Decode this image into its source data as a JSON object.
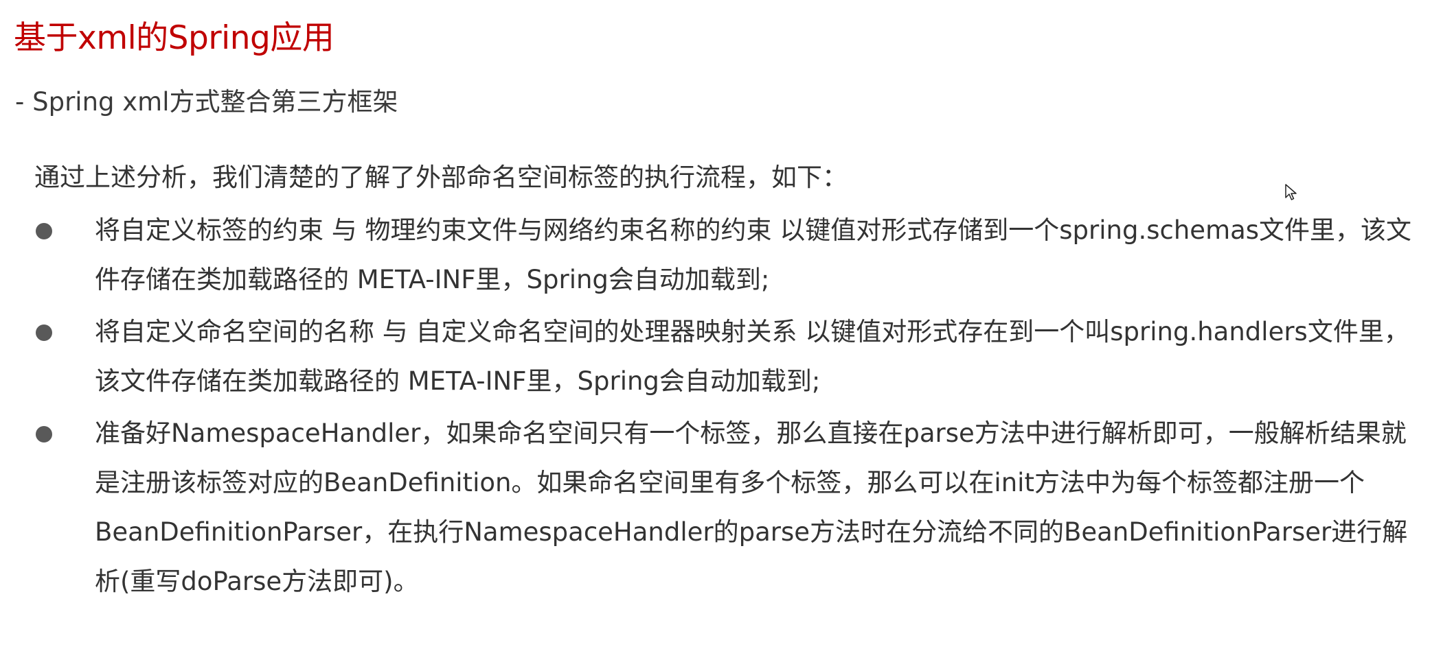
{
  "title": "基于xml的Spring应用",
  "subtitle": "- Spring xml方式整合第三方框架",
  "intro": "通过上述分析，我们清楚的了解了外部命名空间标签的执行流程，如下：",
  "bullets": [
    {
      "text": "将自定义标签的约束 与 物理约束文件与网络约束名称的约束 以键值对形式存储到一个spring.schemas文件里，该文件存储在类加载路径的 META-INF里，Spring会自动加载到;"
    },
    {
      "text": "将自定义命名空间的名称 与 自定义命名空间的处理器映射关系 以键值对形式存在到一个叫spring.handlers文件里，该文件存储在类加载路径的 META-INF里，Spring会自动加载到;"
    },
    {
      "text": "准备好NamespaceHandler，如果命名空间只有一个标签，那么直接在parse方法中进行解析即可，一般解析结果就是注册该标签对应的BeanDefinition。如果命名空间里有多个标签，那么可以在init方法中为每个标签都注册一个BeanDefinitionParser，在执行NamespaceHandler的parse方法时在分流给不同的BeanDefinitionParser进行解析(重写doParse方法即可)。"
    }
  ],
  "icons": {
    "bullet": "bullet-dot-icon",
    "cursor": "mouse-pointer-icon"
  },
  "colors": {
    "title": "#c00000",
    "text": "#333333",
    "bullet": "#595959",
    "background": "#ffffff"
  }
}
